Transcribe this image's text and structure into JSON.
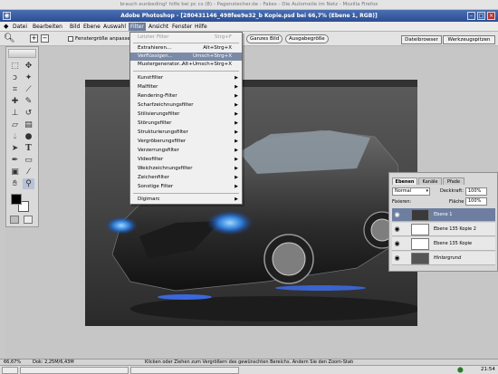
{
  "firefox": {
    "title": "brauch eunbeding! hilfe bei pc cs (8) - Pagenstecher.de - Fakes - Die Automeile im Netz - Mozilla Firefox"
  },
  "photoshop": {
    "title": "Adobe Photoshop - [280431146_498fee9e32_b Kopie.psd bei 66,7% (Ebene 1, RGB)]"
  },
  "menubar": {
    "items": [
      "Datei",
      "Bearbeiten",
      "Bild",
      "Ebene",
      "Auswahl",
      "Filter",
      "Ansicht",
      "Fenster",
      "Hilfe"
    ]
  },
  "options": {
    "fit_label": "Fenstergröße anpassen",
    "whole_image": "Ganzes Bild",
    "print_size": "Ausgabegröße",
    "tab_file_browser": "Dateibrowser",
    "tab_brushes": "Werkzeugspitzen"
  },
  "filter_menu": {
    "last_filter": {
      "label": "Letzter Filter",
      "shortcut": "Strg+F"
    },
    "extract": {
      "label": "Extrahieren...",
      "shortcut": "Alt+Strg+X"
    },
    "liquify": {
      "label": "Verflüssigen...",
      "shortcut": "Umsch+Strg+X"
    },
    "pattern": {
      "label": "Mustergenerator...",
      "shortcut": "Alt+Umsch+Strg+X"
    },
    "submenus": [
      "Kunstfilter",
      "Malfilter",
      "Rendering-Filter",
      "Scharfzeichnungsfilter",
      "Stilisierungsfilter",
      "Störungsfilter",
      "Strukturierungsfilter",
      "Vergröberungsfilter",
      "Verzerrungsfilter",
      "Videofilter",
      "Weichzeichnungsfilter",
      "Zeichenfilter",
      "Sonstige Filter"
    ],
    "digimarc": "Digimarc"
  },
  "layers_panel": {
    "tabs": [
      "Ebenen",
      "Kanäle",
      "Pfade"
    ],
    "blend_mode": "Normal",
    "opacity_label": "Deckkraft:",
    "opacity_value": "100%",
    "lock_label": "Fixieren:",
    "fill_label": "Fläche",
    "fill_value": "100%",
    "layers": [
      {
        "name": "Ebene 1",
        "selected": true
      },
      {
        "name": "Ebene 135 Kopie 2",
        "selected": false
      },
      {
        "name": "Ebene 135 Kopie",
        "selected": false
      },
      {
        "name": "Hintergrund",
        "selected": false
      }
    ]
  },
  "status": {
    "zoom": "66,67%",
    "doc": "Dok: 2,25M/6,43M",
    "hint": "Klicken oder Ziehen zum Vergrößern des gewünschten Bereichs. Ändern Sie den Zoom-Status in der Optionsleiste."
  },
  "taskbar": {
    "time": "21:54"
  },
  "colors": {
    "accent": "#2c4e93",
    "menu_highlight": "#7b8aa6"
  }
}
